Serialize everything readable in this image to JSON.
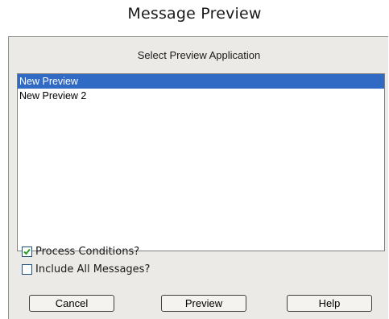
{
  "page_title": "Message Preview",
  "dialog": {
    "header": "Select Preview Application",
    "list": {
      "items": [
        {
          "label": "New Preview",
          "selected": true
        },
        {
          "label": "New Preview 2",
          "selected": false
        }
      ]
    },
    "options": {
      "process_conditions": {
        "label": "Process Conditions?",
        "checked": true
      },
      "include_all_messages": {
        "label": "Include All Messages?",
        "checked": false
      }
    },
    "buttons": {
      "cancel": "Cancel",
      "preview": "Preview",
      "help": "Help"
    }
  },
  "colors": {
    "selection": "#316ac5",
    "dialog_bg": "#eceae6",
    "checkbox_border": "#1c5180"
  }
}
